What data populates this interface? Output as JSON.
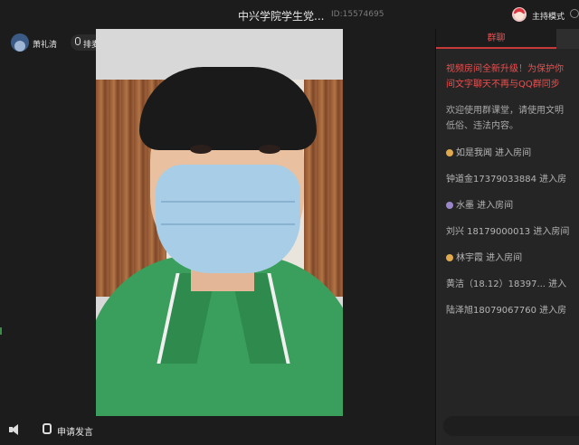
{
  "header": {
    "title": "中兴学院学生党...",
    "room_id": "ID:15574695",
    "host_mode_label": "主持模式"
  },
  "left_panel": {
    "user_name": "萧礼清",
    "mic_label": "排麦"
  },
  "bottom_bar": {
    "apply_speak_label": "申请发言"
  },
  "chat": {
    "tabs": [
      {
        "label": "群聊"
      }
    ],
    "notice_lines": [
      "视频房间全新升级！为保护你",
      "间文字聊天不再与QQ群同步"
    ],
    "system_lines": [
      "欢迎使用群课堂，请使用文明",
      "低俗、违法内容。"
    ],
    "messages": [
      {
        "badge": "gold",
        "text": "如是我闻 进入房间"
      },
      {
        "badge": "",
        "text": "钟道金17379033884 进入房"
      },
      {
        "badge": "purple",
        "text": "水墨 进入房间"
      },
      {
        "badge": "",
        "text": "刘兴 18179000013 进入房间"
      },
      {
        "badge": "gold",
        "text": "林宇霞 进入房间"
      },
      {
        "badge": "",
        "text": "黄洁（18.12）18397... 进入"
      },
      {
        "badge": "",
        "text": "陆泽旭18079067760 进入房"
      }
    ]
  },
  "colors": {
    "accent": "#c63a3a",
    "notice": "#f04d4d",
    "background": "#1c1c1c",
    "chat_bg": "#252525"
  }
}
